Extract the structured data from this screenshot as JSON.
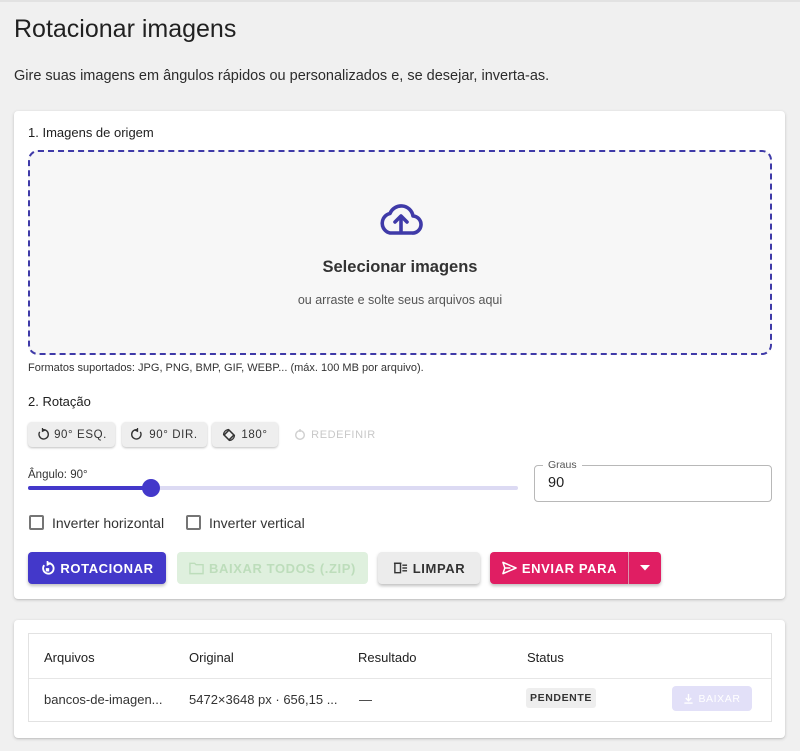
{
  "page": {
    "title": "Rotacionar imagens",
    "subtitle": "Gire suas imagens em ângulos rápidos ou personalizados e, se desejar, inverta-as."
  },
  "source": {
    "section_label": "1. Imagens de origem",
    "dropzone_title": "Selecionar imagens",
    "dropzone_subtitle": "ou arraste e solte seus arquivos aqui",
    "dropzone_icon": "cloud-upload-icon",
    "formats_note": "Formatos suportados: JPG, PNG, BMP, GIF, WEBP... (máx. 100 MB por arquivo)."
  },
  "rotation": {
    "section_label": "2. Rotação",
    "buttons": {
      "left": "90° ESQ.",
      "right": "90° DIR.",
      "half": "180°",
      "reset": "REDEFINIR"
    },
    "angle_label": "Ângulo: 90°",
    "slider_fraction": 0.25,
    "degrees_label": "Graus",
    "degrees_value": "90",
    "flip_horizontal": "Inverter horizontal",
    "flip_vertical": "Inverter vertical"
  },
  "actions": {
    "rotate": "ROTACIONAR",
    "download_all": "BAIXAR TODOS (.ZIP)",
    "clear": "LIMPAR",
    "send_to": "ENVIAR PARA"
  },
  "files_table": {
    "headers": [
      "Arquivos",
      "Original",
      "Resultado",
      "Status"
    ],
    "rows": [
      {
        "file": "bancos-de-imagen...",
        "original": "5472×3648 px · 656,15 ...",
        "result": "—",
        "status": "PENDENTE",
        "download": "BAIXAR"
      }
    ]
  },
  "colors": {
    "primary": "#4338ca",
    "accent": "#e01e63",
    "dropzone_border": "#3f3aa8"
  }
}
